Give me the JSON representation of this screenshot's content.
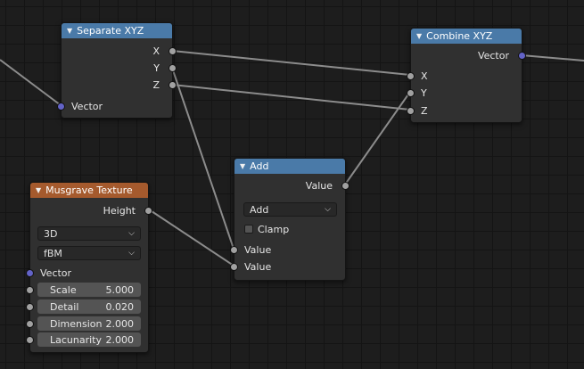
{
  "nodes": {
    "separate_xyz": {
      "title": "Separate XYZ",
      "outputs": [
        "X",
        "Y",
        "Z"
      ],
      "input": "Vector"
    },
    "combine_xyz": {
      "title": "Combine XYZ",
      "output": "Vector",
      "inputs": [
        "X",
        "Y",
        "Z"
      ]
    },
    "add": {
      "title": "Add",
      "output": "Value",
      "operation": "Add",
      "clamp_label": "Clamp",
      "inputs": [
        "Value",
        "Value"
      ]
    },
    "musgrave": {
      "title": "Musgrave Texture",
      "output": "Height",
      "dimensions": "3D",
      "type": "fBM",
      "vector_label": "Vector",
      "fields": [
        {
          "label": "Scale",
          "value": "5.000"
        },
        {
          "label": "Detail",
          "value": "0.020"
        },
        {
          "label": "Dimension",
          "value": "2.000"
        },
        {
          "label": "Lacunarity",
          "value": "2.000"
        }
      ]
    }
  },
  "colors": {
    "header_blue": "#4a7aa8",
    "header_orange": "#a55a2d",
    "float_socket": "#a1a1a1",
    "vector_socket": "#6363c7",
    "link": "#8a8a8a"
  }
}
